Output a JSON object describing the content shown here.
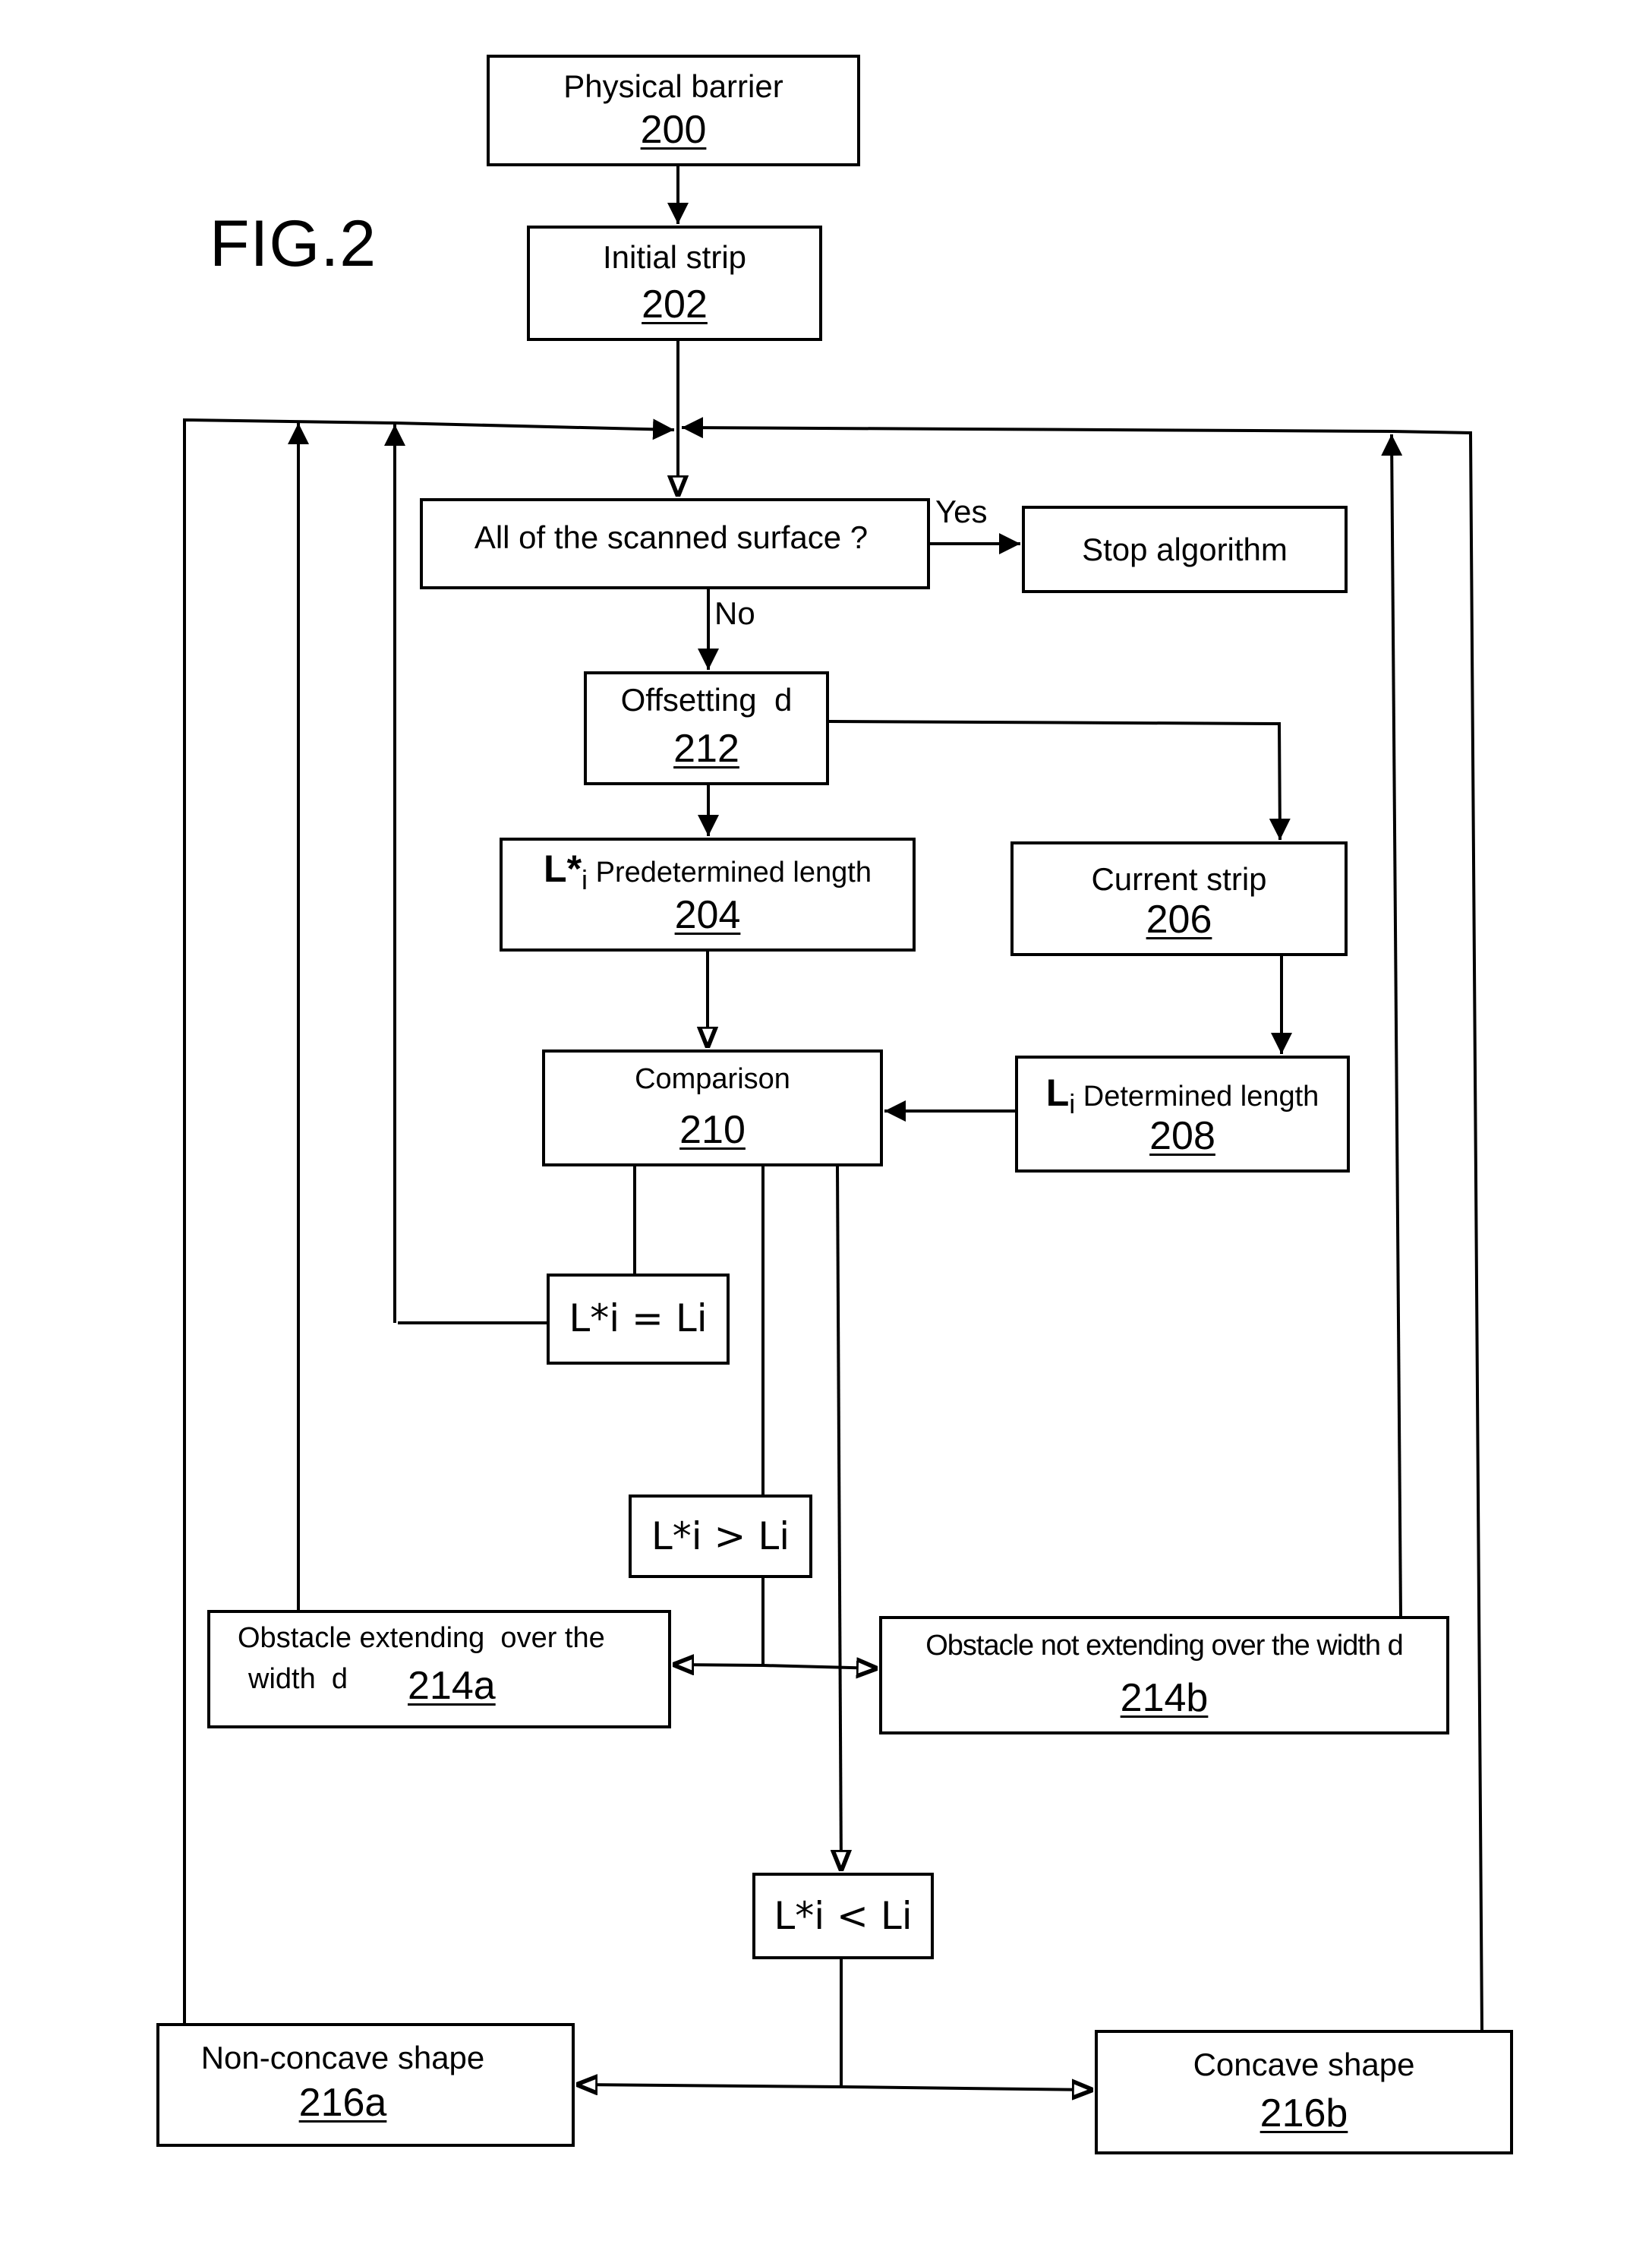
{
  "figure": {
    "title": "FIG.2",
    "edge_labels": {
      "yes": "Yes",
      "no": "No"
    }
  },
  "nodes": {
    "physical_barrier": {
      "label": "Physical barrier",
      "ref": "200"
    },
    "initial_strip": {
      "label": "Initial strip",
      "ref": "202"
    },
    "decision_scanned": {
      "label": "All of the scanned surface ?"
    },
    "stop_algorithm": {
      "label": "Stop algorithm"
    },
    "offsetting": {
      "label": "Offsetting  d",
      "ref": "212"
    },
    "predetermined_length": {
      "symbol": "L*",
      "subscript": "i",
      "label": "Predetermined length",
      "ref": "204"
    },
    "current_strip": {
      "label": "Current strip",
      "ref": "206"
    },
    "comparison": {
      "label": "Comparison",
      "ref": "210"
    },
    "determined_length": {
      "symbol": "L",
      "subscript": "i",
      "label": "Determined length",
      "ref": "208"
    },
    "cond_equal": {
      "label": "L*i = Li"
    },
    "cond_greater": {
      "label": "L*i > Li"
    },
    "cond_less": {
      "label": "L*i < Li"
    },
    "obstacle_extending": {
      "line1": "Obstacle extending  over the",
      "line2": "width  d",
      "ref": "214a"
    },
    "obstacle_not_extending": {
      "label": "Obstacle not extending over the width d",
      "ref": "214b"
    },
    "non_concave": {
      "label": "Non-concave shape",
      "ref": "216a"
    },
    "concave": {
      "label": "Concave shape",
      "ref": "216b"
    }
  },
  "edges": [
    {
      "from": "physical_barrier",
      "to": "initial_strip"
    },
    {
      "from": "initial_strip",
      "to": "decision_scanned"
    },
    {
      "from": "decision_scanned",
      "to": "stop_algorithm",
      "label": "Yes"
    },
    {
      "from": "decision_scanned",
      "to": "offsetting",
      "label": "No"
    },
    {
      "from": "offsetting",
      "to": "predetermined_length"
    },
    {
      "from": "offsetting",
      "to": "current_strip"
    },
    {
      "from": "predetermined_length",
      "to": "comparison"
    },
    {
      "from": "current_strip",
      "to": "determined_length"
    },
    {
      "from": "determined_length",
      "to": "comparison"
    },
    {
      "from": "comparison",
      "to": "cond_equal"
    },
    {
      "from": "comparison",
      "to": "cond_greater"
    },
    {
      "from": "comparison",
      "to": "cond_less"
    },
    {
      "from": "cond_equal",
      "to": "decision_scanned"
    },
    {
      "from": "cond_greater",
      "to": "obstacle_extending"
    },
    {
      "from": "cond_greater",
      "to": "obstacle_not_extending"
    },
    {
      "from": "cond_less",
      "to": "non_concave"
    },
    {
      "from": "cond_less",
      "to": "concave"
    },
    {
      "from": "obstacle_extending",
      "to": "decision_scanned"
    },
    {
      "from": "obstacle_not_extending",
      "to": "decision_scanned"
    },
    {
      "from": "non_concave",
      "to": "decision_scanned"
    },
    {
      "from": "concave",
      "to": "decision_scanned"
    }
  ]
}
